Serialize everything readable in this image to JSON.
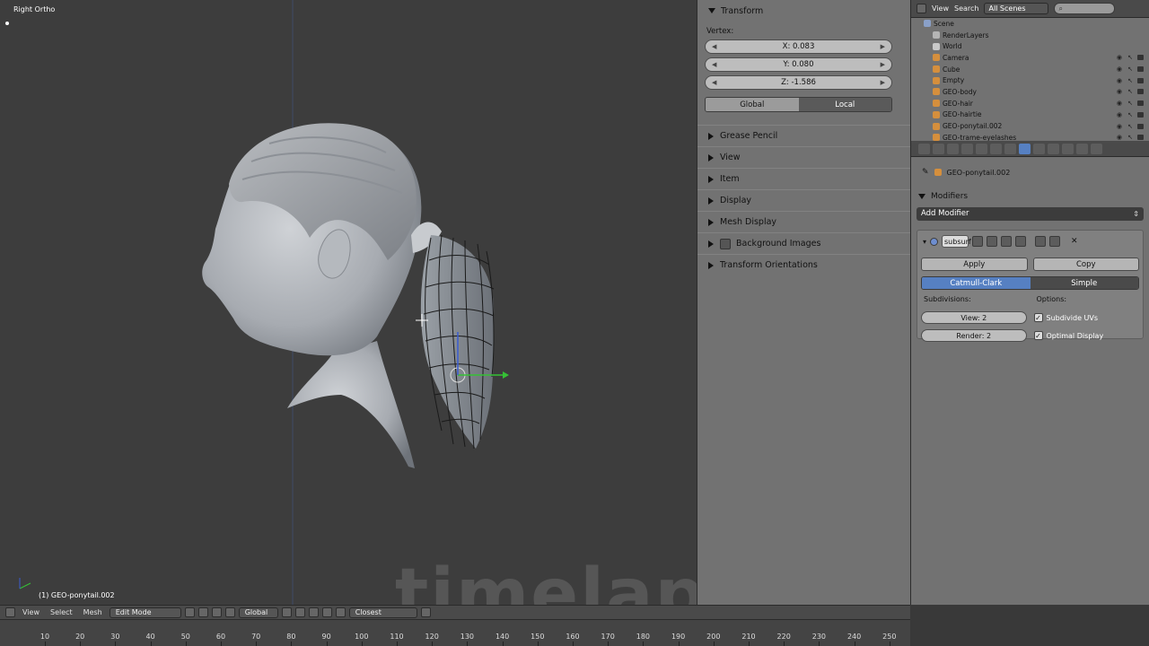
{
  "viewport": {
    "view_label": "Right Ortho",
    "object_label": "(1) GEO-ponytail.002",
    "watermark": "timelapse"
  },
  "header": {
    "menus": [
      "View",
      "Select",
      "Mesh"
    ],
    "mode": "Edit Mode",
    "orientation": "Global",
    "snap": "Closest"
  },
  "timeline": {
    "ticks": [
      "10",
      "20",
      "30",
      "40",
      "50",
      "60",
      "70",
      "80",
      "90",
      "100",
      "110",
      "120",
      "130",
      "140",
      "150",
      "160",
      "170",
      "180",
      "190",
      "200",
      "210",
      "220",
      "230",
      "240",
      "250"
    ]
  },
  "npanel": {
    "transform_title": "Transform",
    "vertex_label": "Vertex:",
    "x": "X: 0.083",
    "y": "Y: 0.080",
    "z": "Z: -1.586",
    "global": "Global",
    "local": "Local",
    "sections": [
      "Grease Pencil",
      "View",
      "Item",
      "Display",
      "Mesh Display",
      "Background Images",
      "Transform Orientations"
    ]
  },
  "outliner": {
    "view": "View",
    "search": "Search",
    "scenes": "All Scenes",
    "items": [
      {
        "name": "Scene",
        "color": "#8aa0c8"
      },
      {
        "name": "RenderLayers",
        "color": "#b5b5b5"
      },
      {
        "name": "World",
        "color": "#c9c9c9"
      },
      {
        "name": "Camera",
        "color": "#d58f3d"
      },
      {
        "name": "Cube",
        "color": "#d58f3d"
      },
      {
        "name": "Empty",
        "color": "#d58f3d"
      },
      {
        "name": "GEO-body",
        "color": "#d58f3d"
      },
      {
        "name": "GEO-hair",
        "color": "#d58f3d"
      },
      {
        "name": "GEO-hairtie",
        "color": "#d58f3d"
      },
      {
        "name": "GEO-ponytail.002",
        "color": "#d58f3d"
      },
      {
        "name": "GEO-trame-eyelashes",
        "color": "#d58f3d"
      }
    ]
  },
  "properties": {
    "object": "GEO-ponytail.002",
    "panel_title": "Modifiers",
    "add_modifier": "Add Modifier",
    "modifier_name": "subsurf",
    "apply": "Apply",
    "copy": "Copy",
    "catmull": "Catmull-Clark",
    "simple": "Simple",
    "subdivisions": "Subdivisions:",
    "options": "Options:",
    "view_levels": "View: 2",
    "render_levels": "Render: 2",
    "subdivide_uvs": "Subdivide UVs",
    "optimal_display": "Optimal Display"
  },
  "colors": {
    "accent": "#5680c2",
    "panel": "#727272",
    "viewport": "#3d3d3d"
  }
}
